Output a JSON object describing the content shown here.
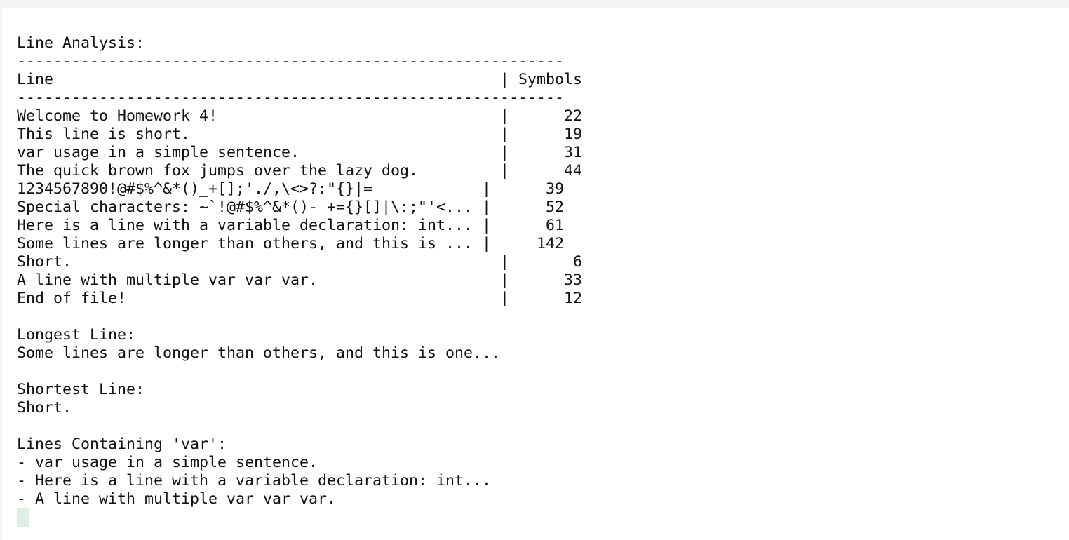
{
  "analysis_title": "Line Analysis:",
  "separator": "------------------------------------------------------------",
  "table_header": "Line                                                 | Symbols",
  "rows": [
    "Welcome to Homework 4!                               |      22",
    "This line is short.                                  |      19",
    "var usage in a simple sentence.                      |      31",
    "The quick brown fox jumps over the lazy dog.         |      44",
    "1234567890!@#$%^&*()_+[];'./,\\<>?:\"{}|=            |      39",
    "Special characters: ~`!@#$%^&*()-_+={}[]|\\:;\"'<... |      52",
    "Here is a line with a variable declaration: int... |      61",
    "Some lines are longer than others, and this is ... |     142",
    "Short.                                               |       6",
    "A line with multiple var var var.                    |      33",
    "End of file!                                         |      12"
  ],
  "longest_label": "Longest Line:",
  "longest_value": "Some lines are longer than others, and this is one...",
  "shortest_label": "Shortest Line:",
  "shortest_value": "Short.",
  "var_label": "Lines Containing 'var':",
  "var_lines": [
    "- var usage in a simple sentence.",
    "- Here is a line with a variable declaration: int...",
    "- A line with multiple var var var."
  ]
}
